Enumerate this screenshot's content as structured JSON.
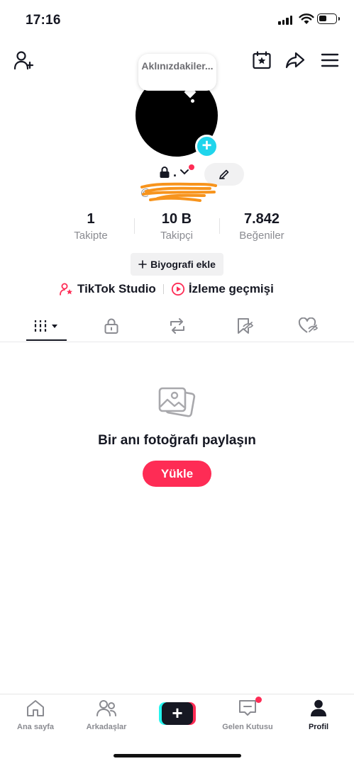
{
  "status_bar": {
    "time": "17:16"
  },
  "profile": {
    "note_bubble": "Aklınızdakiler...",
    "username": "@",
    "stats": [
      {
        "value": "1",
        "label": "Takipte"
      },
      {
        "value": "10 B",
        "label": "Takipçi"
      },
      {
        "value": "7.842",
        "label": "Beğeniler"
      }
    ],
    "bio_button": "Biyografi ekle",
    "links": {
      "studio": "TikTok Studio",
      "history": "İzleme geçmişi"
    }
  },
  "empty_state": {
    "title": "Bir anı fotoğrafı paylaşın",
    "upload_button": "Yükle"
  },
  "bottom_nav": [
    {
      "label": "Ana sayfa",
      "icon": "home-icon"
    },
    {
      "label": "Arkadaşlar",
      "icon": "friends-icon"
    },
    {
      "label": "",
      "icon": "create-icon"
    },
    {
      "label": "Gelen Kutusu",
      "icon": "inbox-icon"
    },
    {
      "label": "Profil",
      "icon": "profile-icon"
    }
  ],
  "colors": {
    "brand_red": "#fe2c55",
    "brand_cyan": "#20d5ec",
    "text": "#161823",
    "muted": "#8a8b91"
  }
}
